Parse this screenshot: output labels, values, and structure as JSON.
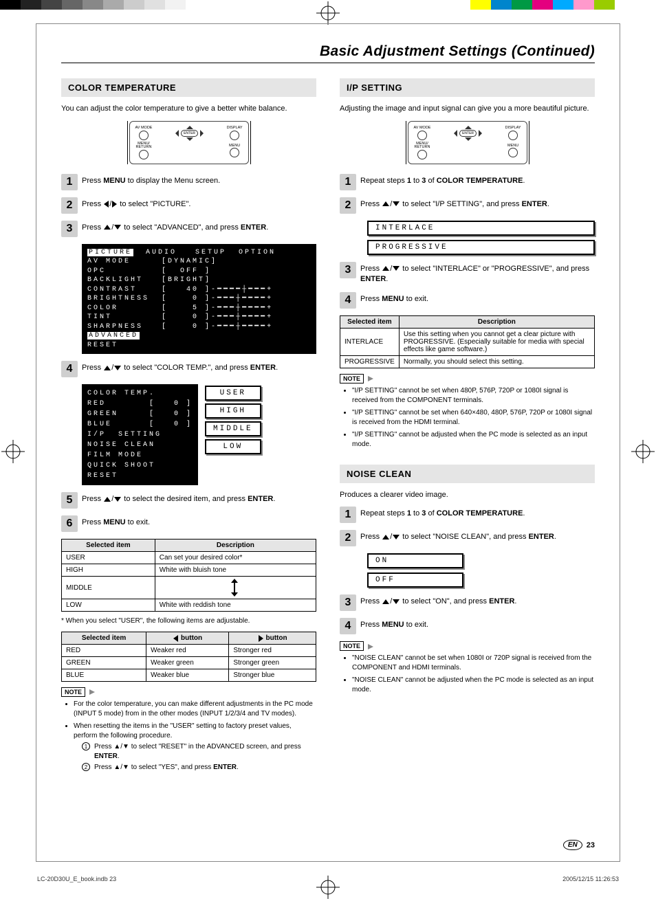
{
  "page": {
    "title": "Basic Adjustment Settings (Continued)",
    "lang_badge": "EN",
    "number": "23"
  },
  "print_footer": {
    "file": "LC-20D30U_E_book.indb   23",
    "timestamp": "2005/12/15   11:26:53"
  },
  "remote": {
    "av_mode": "AV MODE",
    "display": "DISPLAY",
    "enter": "ENTER",
    "menu_return": "MENU/\nRETURN",
    "menu": "MENU"
  },
  "left": {
    "title": "COLOR TEMPERATURE",
    "intro": "You can adjust the color temperature to give a better white balance.",
    "steps": {
      "s1": "Press <b>MENU</b> to display the Menu screen.",
      "s2_pre": "Press ",
      "s2_post": " to select \"PICTURE\".",
      "s3_pre": "Press ",
      "s3_post": " to select \"ADVANCED\", and press <b>ENTER</b>.",
      "s4_pre": "Press ",
      "s4_post": " to select \"COLOR TEMP.\", and press <b>ENTER</b>.",
      "s5_pre": "Press ",
      "s5_post": " to select the desired item, and press <b>ENTER</b>.",
      "s6": "Press <b>MENU</b> to exit."
    },
    "osd1_tabs": "PICTURE  AUDIO   SETUP  OPTION",
    "osd1_lines": [
      "AV MODE     [DYNAMIC]",
      "OPC         [  OFF ]",
      "BACKLIGHT   [BRIGHT]",
      "CONTRAST    [   40 ]-━━━━┼━━━+",
      "BRIGHTNESS  [    0 ]-━━━┼━━━━+",
      "COLOR       [    5 ]-━━━┼━━━━+",
      "TINT        [    0 ]-━━━┼━━━━+",
      "SHARPNESS   [    0 ]-━━━┼━━━━+",
      "ADVANCED",
      "RESET"
    ],
    "osd2_menu": [
      "COLOR TEMP.",
      "RED       [   0 ]",
      "GREEN     [   0 ]",
      "BLUE      [   0 ]",
      "I/P  SETTING",
      "NOISE CLEAN",
      "FILM MODE",
      "QUICK SHOOT",
      "RESET"
    ],
    "osd2_opts": [
      "USER",
      "HIGH",
      "MIDDLE",
      "LOW"
    ],
    "table1": {
      "head_item": "Selected item",
      "head_desc": "Description",
      "rows": [
        {
          "item": "USER",
          "desc": "Can set your desired color*"
        },
        {
          "item": "HIGH",
          "desc": "White with bluish tone"
        },
        {
          "item": "MIDDLE",
          "desc": ""
        },
        {
          "item": "LOW",
          "desc": "White with reddish tone"
        }
      ]
    },
    "footnote": "* When you select \"USER\", the following items are adjustable.",
    "table2": {
      "head_item": "Selected item",
      "head_left": " button",
      "head_right": " button",
      "rows": [
        {
          "item": "RED",
          "l": "Weaker red",
          "r": "Stronger red"
        },
        {
          "item": "GREEN",
          "l": "Weaker green",
          "r": "Stronger green"
        },
        {
          "item": "BLUE",
          "l": "Weaker blue",
          "r": "Stronger blue"
        }
      ]
    },
    "note_label": "NOTE",
    "notes": [
      "For the color temperature, you can make different adjustments in the PC mode (INPUT 5 mode) from in the other modes (INPUT 1/2/3/4 and TV modes).",
      "When resetting the items in the \"USER\" setting to factory preset values, perform the following procedure."
    ],
    "note_subs": [
      "Press ▲/▼ to select \"RESET\" in the ADVANCED screen, and press <b>ENTER</b>.",
      "Press ▲/▼ to select \"YES\", and press <b>ENTER</b>."
    ]
  },
  "right": {
    "ip": {
      "title": "I/P SETTING",
      "intro": "Adjusting the image and input signal can give you a more beautiful picture.",
      "steps": {
        "s1": "Repeat steps <b>1</b> to <b>3</b> of <b>COLOR TEMPERATURE</b>.",
        "s2_pre": "Press ",
        "s2_post": " to select \"I/P SETTING\", and press <b>ENTER</b>.",
        "s3_pre": "Press ",
        "s3_post": " to select \"INTERLACE\" or \"PROGRESSIVE\", and press <b>ENTER</b>.",
        "s4": "Press <b>MENU</b> to exit."
      },
      "osd_opts": [
        "INTERLACE",
        "PROGRESSIVE"
      ],
      "table": {
        "head_item": "Selected item",
        "head_desc": "Description",
        "rows": [
          {
            "item": "INTERLACE",
            "desc": "Use this setting when you cannot get a clear picture with PROGRESSIVE. (Especially suitable for media with special effects like game software.)"
          },
          {
            "item": "PROGRESSIVE",
            "desc": "Normally, you should select this setting."
          }
        ]
      },
      "note_label": "NOTE",
      "notes": [
        "\"I/P SETTING\" cannot be set when 480P, 576P, 720P or 1080I signal is received from the COMPONENT terminals.",
        "\"I/P SETTING\" cannot be set when 640×480, 480P, 576P, 720P or 1080I signal is received from the HDMI terminal.",
        "\"I/P SETTING\" cannot be adjusted when the PC mode is selected as an input mode."
      ]
    },
    "nc": {
      "title": "NOISE CLEAN",
      "intro": "Produces a clearer video image.",
      "steps": {
        "s1": "Repeat steps <b>1</b> to <b>3</b> of <b>COLOR TEMPERATURE</b>.",
        "s2_pre": "Press ",
        "s2_post": " to select \"NOISE CLEAN\", and press <b>ENTER</b>.",
        "s3_pre": "Press ",
        "s3_post": " to select \"ON\", and press <b>ENTER</b>.",
        "s4": "Press <b>MENU</b> to exit."
      },
      "osd_opts": [
        "ON",
        "OFF"
      ],
      "note_label": "NOTE",
      "notes": [
        "\"NOISE CLEAN\" cannot be set when 1080I or 720P signal is received from the COMPONENT and HDMI terminals.",
        "\"NOISE CLEAN\" cannot be adjusted when the PC mode is selected as an input mode."
      ]
    }
  }
}
